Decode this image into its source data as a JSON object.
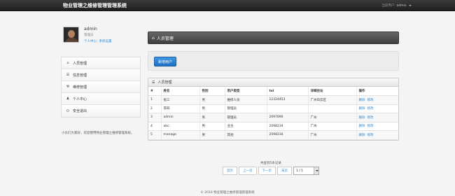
{
  "app": {
    "title": "物业管理之维修管理管理系统"
  },
  "topbar": {
    "user_prefix": "当前用户:",
    "user_name": "admin"
  },
  "profile": {
    "name": "admin",
    "role": "管理员",
    "link_center": "个人中心",
    "link_settings": "系统设置"
  },
  "sidebar": {
    "items": [
      {
        "icon": "home-icon",
        "label": "人员管理"
      },
      {
        "icon": "list-icon",
        "label": "信息管理"
      },
      {
        "icon": "wrench-icon",
        "label": "维修管理"
      },
      {
        "icon": "user-icon",
        "label": "个人中心"
      },
      {
        "icon": "power-icon",
        "label": "安全退出"
      }
    ],
    "welcome": "小东们大家好，欢迎使用物业管理之维修管理系统。"
  },
  "main": {
    "title": "人员管理",
    "add_button": "新增用户",
    "panel_title": "人员管理",
    "columns": [
      "#",
      "姓名",
      "性别",
      "用户类型",
      "tel",
      "详细住址",
      "操作"
    ],
    "rows": [
      [
        "1",
        "张三",
        "男",
        "维修人员",
        "12324453",
        "广州白云区"
      ],
      [
        "2",
        "李四",
        "男",
        "管理员",
        "",
        ""
      ],
      [
        "3",
        "admin",
        "男",
        "管理员",
        "2097890",
        "广州"
      ],
      [
        "4",
        "abc",
        "男",
        "业主",
        "2098234",
        "广州"
      ],
      [
        "5",
        "manage",
        "男",
        "其他",
        "2098234",
        "广州"
      ]
    ],
    "op_delete": "删除",
    "op_edit": "修改"
  },
  "pager": {
    "info": "共查到5条记录",
    "first": "首页",
    "prev": "上一页",
    "next": "下一页",
    "last": "末页",
    "page_select": "1 / 1"
  },
  "footer": {
    "text": "© 2016 物业管理之维修管理管理系统"
  }
}
